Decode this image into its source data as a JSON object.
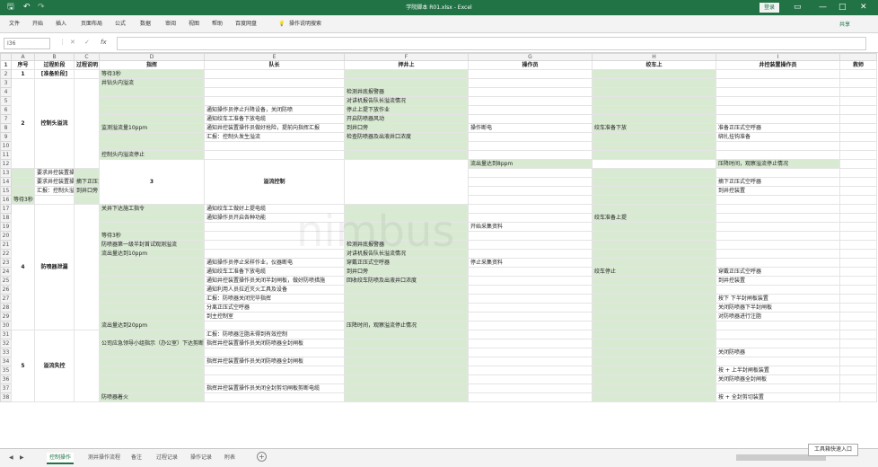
{
  "window": {
    "title": "学院脚本 R01.xlsx - Excel",
    "login": "登录",
    "qat": [
      "↶",
      "↷"
    ],
    "controls": [
      "—",
      "□",
      "✕"
    ]
  },
  "menu": {
    "items": [
      "文件",
      "开始",
      "插入",
      "页面布局",
      "公式",
      "数据",
      "审阅",
      "视图",
      "帮助",
      "百度网盘",
      "操作说明搜索"
    ],
    "share": "共享"
  },
  "formula_bar": {
    "name_box": "I36",
    "fx": "fx",
    "value": ""
  },
  "columns": [
    "",
    "A",
    "B",
    "C",
    "D",
    "E",
    "F",
    "G",
    "H",
    "I"
  ],
  "header_row": [
    "序号",
    "过程阶段",
    "过程说明",
    "指挥",
    "队长",
    "押井上",
    "操作员",
    "绞车上",
    "井控装置操作员",
    "救师"
  ],
  "rows": [
    {
      "n": "2",
      "d": "等待3秒",
      "e": "",
      "f": "",
      "g": "",
      "h": "",
      "i": ""
    },
    {
      "n": "3",
      "d": "井钻头内溢流",
      "e": "",
      "f": "",
      "g": "",
      "h": "",
      "i": ""
    },
    {
      "n": "4",
      "d": "",
      "e": "",
      "f": "检测井底报警器",
      "g": "",
      "h": "",
      "i": ""
    },
    {
      "n": "5",
      "d": "",
      "e": "",
      "f": "对讲机报告队长溢流情况",
      "g": "",
      "h": "",
      "i": ""
    },
    {
      "n": "6",
      "d": "",
      "e": "通知操作员停止升降设备，关闭防喷",
      "f": "停止上提下放作业",
      "g": "",
      "h": "",
      "i": ""
    },
    {
      "n": "7",
      "d": "",
      "e": "通知绞车工准备下放电缆",
      "f": "开启防喷器风动",
      "g": "",
      "h": "",
      "i": ""
    },
    {
      "n": "8",
      "d": "监测溢流量10ppm",
      "e": "通知井控装置操作员做好抢险，提前向指挥汇报",
      "f": "到井口旁",
      "g": "操作断电",
      "h": "绞车准备下放",
      "i": "准备正压式空呼器"
    },
    {
      "n": "9",
      "d": "",
      "e": "汇报：控制头发生溢流",
      "f": "检查防喷器及出液井口浓度",
      "g": "",
      "h": "",
      "i": "绑扎挂钩准备"
    },
    {
      "n": "10",
      "d": "",
      "e": "",
      "f": "",
      "g": "",
      "h": "",
      "i": ""
    },
    {
      "n": "11",
      "d": "控制头内溢流停止",
      "e": "",
      "f": "",
      "g": "",
      "h": "",
      "i": ""
    },
    {
      "n": "12",
      "d": "流出量达到8ppm",
      "e": "",
      "f": "压降时间，观察溢流停止情况",
      "g": "",
      "h": "",
      "i": ""
    },
    {
      "n": "13",
      "d": "",
      "e": "要求井控装置操作员及井口相关人员撤下全部",
      "f": "",
      "g": "",
      "h": "",
      "i": ""
    },
    {
      "n": "14",
      "d": "",
      "e": "要求井控装置操作员及井口相关人员戴好防护",
      "f": "摘下正压式空呼器",
      "g": "",
      "h": "",
      "i": "摘下正压式空呼器"
    },
    {
      "n": "15",
      "d": "",
      "e": "汇报：控制头溢流已停止，请求继续施工",
      "f": "到井口旁",
      "g": "",
      "h": "",
      "i": "到井控装置"
    },
    {
      "n": "16",
      "d": "等待3秒",
      "e": "",
      "f": "",
      "g": "",
      "h": "",
      "i": ""
    },
    {
      "n": "17",
      "d": "关井下达施工指令",
      "e": "通知绞车工做好上提电缆",
      "f": "",
      "g": "",
      "h": "",
      "i": ""
    },
    {
      "n": "18",
      "d": "",
      "e": "通知操作员开启各种功能",
      "f": "",
      "g": "",
      "h": "绞车准备上提",
      "i": ""
    },
    {
      "n": "19",
      "d": "",
      "e": "",
      "f": "",
      "g": "开始采集资料",
      "h": "",
      "i": ""
    },
    {
      "n": "20",
      "d": "等待3秒",
      "e": "",
      "f": "",
      "g": "",
      "h": "",
      "i": ""
    },
    {
      "n": "21",
      "d": "防喷器第一级半封首试观测溢流",
      "e": "",
      "f": "检测井底报警器",
      "g": "",
      "h": "",
      "i": ""
    },
    {
      "n": "22",
      "d": "流出量达到10ppm",
      "e": "",
      "f": "对讲机报告队长溢流情况",
      "g": "",
      "h": "",
      "i": ""
    },
    {
      "n": "23",
      "d": "",
      "e": "通知操作员停止采样作业，仪器断电",
      "f": "穿戴正压式空呼器",
      "g": "停止采集资料",
      "h": "",
      "i": ""
    },
    {
      "n": "24",
      "d": "",
      "e": "通知绞车工准备下放电缆",
      "f": "到井口旁",
      "g": "",
      "h": "绞车停止",
      "i": "穿戴正压式空呼器"
    },
    {
      "n": "25",
      "d": "",
      "e": "通知井控装置操作员关闭半封闸板，做好防喷措施",
      "f": "回收绞车防喷及出液井口浓度",
      "g": "",
      "h": "",
      "i": "到井控装置"
    },
    {
      "n": "26",
      "d": "",
      "e": "通知利用人员拉近灭火工具及设备",
      "f": "",
      "g": "",
      "h": "",
      "i": ""
    },
    {
      "n": "27",
      "d": "",
      "e": "汇报：防喷器关闭完毕指挥",
      "f": "",
      "g": "",
      "h": "",
      "i": "按下 下半封闸板装置"
    },
    {
      "n": "28",
      "d": "",
      "e": "分离正压式空呼器",
      "f": "",
      "g": "",
      "h": "",
      "i": "关闭防喷器下半封闸板"
    },
    {
      "n": "29",
      "d": "",
      "e": "到主控制室",
      "f": "",
      "g": "",
      "h": "",
      "i": "对防喷器进行注脂"
    },
    {
      "n": "30",
      "d": "流出量达到20ppm",
      "e": "",
      "f": "压降时间，观察溢流停止情况",
      "g": "",
      "h": "",
      "i": ""
    },
    {
      "n": "31",
      "d": "",
      "e": "汇报：防喷器注脂未得到有效控制",
      "f": "",
      "g": "",
      "h": "",
      "i": ""
    },
    {
      "n": "32",
      "d": "公司应急领导小组指示（办公室）下达剪断电缆，将剪井口的指令",
      "e": "指挥井控装置操作员关闭防喷器全封闸板",
      "f": "",
      "g": "",
      "h": "",
      "i": ""
    },
    {
      "n": "33",
      "d": "",
      "e": "",
      "f": "",
      "g": "",
      "h": "",
      "i": "关闭防喷器"
    },
    {
      "n": "34",
      "d": "",
      "e": "指挥井控装置操作员关闭防喷器全封闸板",
      "f": "",
      "g": "",
      "h": "",
      "i": ""
    },
    {
      "n": "35",
      "d": "",
      "e": "",
      "f": "",
      "g": "",
      "h": "",
      "i": "按 + 上半封闸板装置"
    },
    {
      "n": "36",
      "d": "",
      "e": "",
      "f": "",
      "g": "",
      "h": "",
      "i": "关闭防喷器全封闸板"
    },
    {
      "n": "37",
      "d": "",
      "e": "指挥井控装置操作员关闭全封剪切闸板剪断电缆",
      "f": "",
      "g": "",
      "h": "",
      "i": ""
    },
    {
      "n": "38",
      "d": "防喷器着火",
      "e": "",
      "f": "",
      "g": "",
      "h": "",
      "i": "按 + 全封剪切装置"
    }
  ],
  "groups": [
    {
      "seq": "1",
      "stage": "[准备阶段]"
    },
    {
      "seq": "2",
      "stage": "控制头溢流"
    },
    {
      "seq": "3",
      "stage": "溢流控制"
    },
    {
      "seq": "4",
      "stage": "防喷器泄漏"
    },
    {
      "seq": "5",
      "stage": "溢流失控"
    }
  ],
  "sheets": [
    "控制操作",
    "测井操作流程",
    "备注",
    "过程记录",
    "操作记录",
    "附表"
  ],
  "toolbox": "工具箱快速入口",
  "watermark": "nimbus"
}
